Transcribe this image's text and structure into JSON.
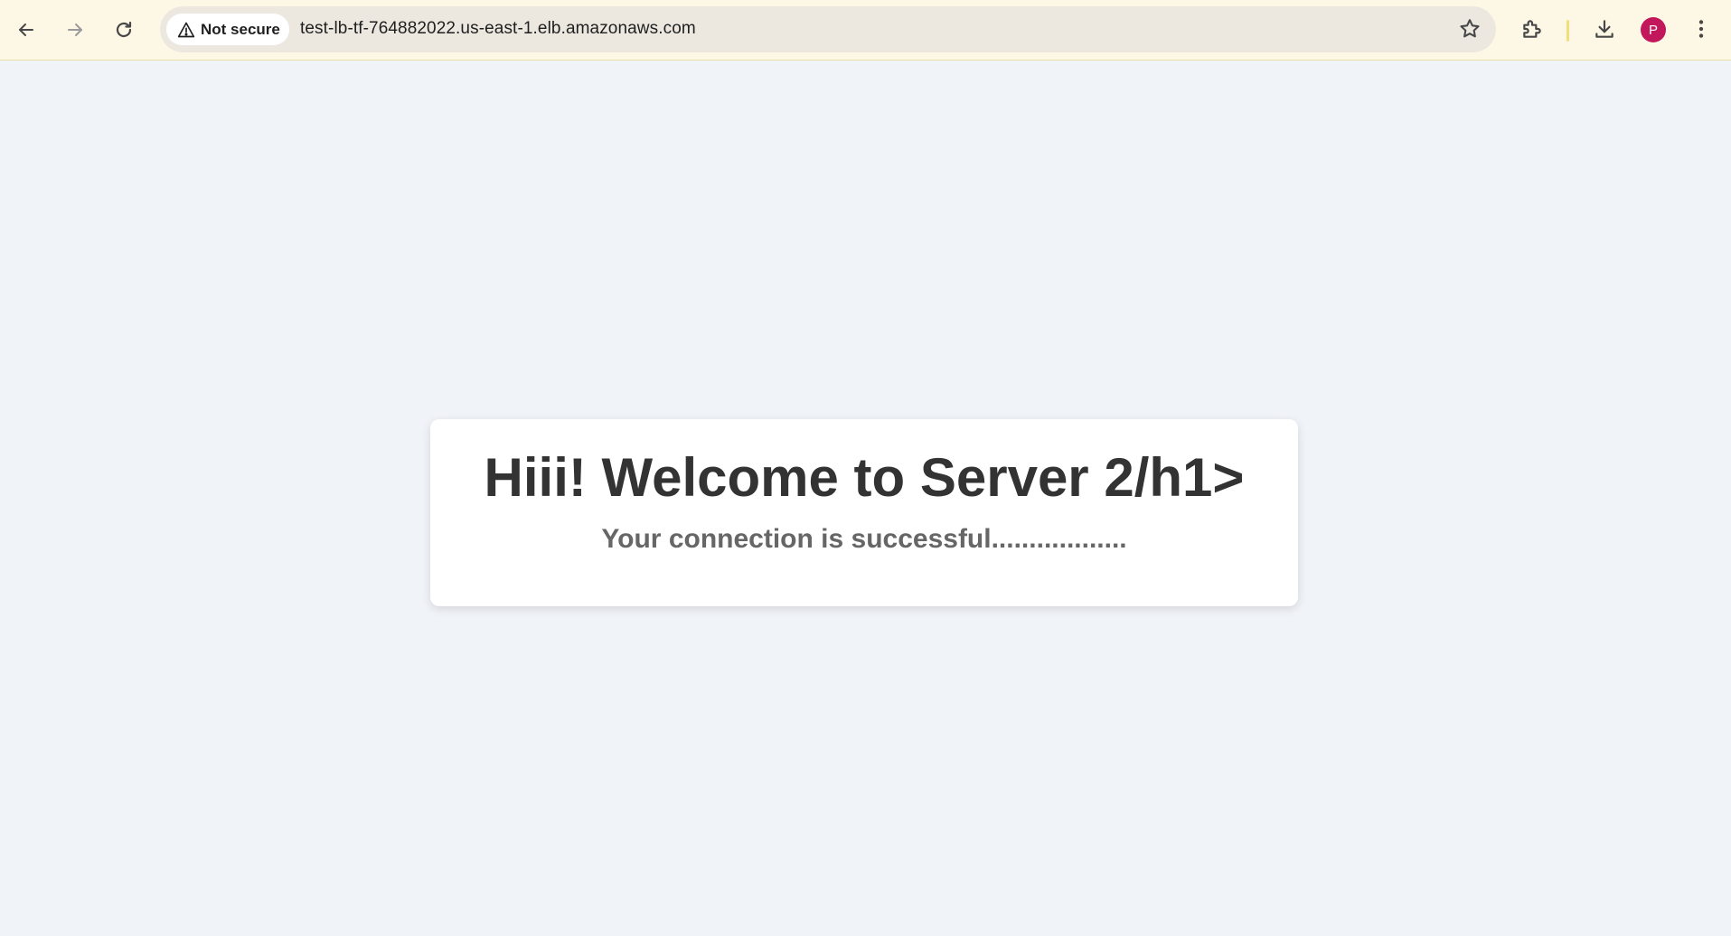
{
  "browser": {
    "security_label": "Not secure",
    "url": "test-lb-tf-764882022.us-east-1.elb.amazonaws.com",
    "profile_initial": "P",
    "icons": {
      "back": "back-arrow-icon",
      "forward": "forward-arrow-icon",
      "reload": "reload-icon",
      "warning": "warning-triangle-icon",
      "bookmark": "star-icon",
      "extensions": "puzzle-icon",
      "downloads": "download-icon",
      "menu": "kebab-menu-icon"
    },
    "colors": {
      "toolbar_bg": "#fdf8e6",
      "avatar_bg": "#c2185b"
    }
  },
  "page": {
    "heading": "Hiii! Welcome to Server 2/h1>",
    "message": "Your connection is successful..................",
    "colors": {
      "background": "#f0f3f8",
      "card": "#ffffff",
      "heading": "#333333",
      "message": "#666666"
    }
  }
}
